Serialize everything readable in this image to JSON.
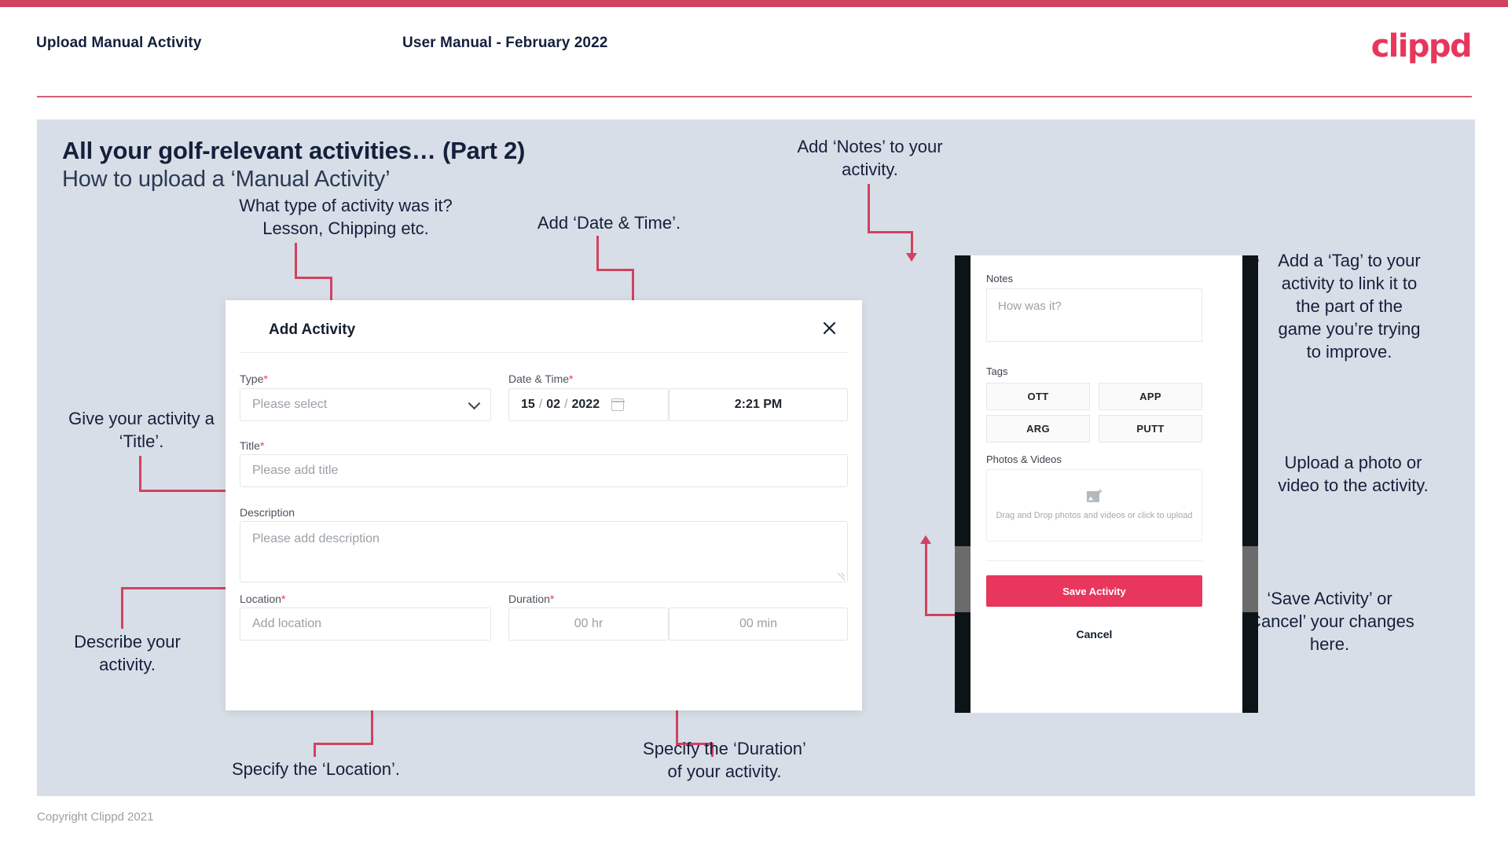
{
  "header": {
    "title": "Upload Manual Activity",
    "subtitle": "User Manual - February 2022",
    "logo": "clippd"
  },
  "slide": {
    "title": "All your golf-relevant activities… (Part 2)",
    "subtitle": "How to upload a ‘Manual Activity’"
  },
  "annotations": {
    "type": "What type of activity was it?\nLesson, Chipping etc.",
    "datetime": "Add ‘Date & Time’.",
    "title": "Give your activity a\n‘Title’.",
    "description": "Describe your\nactivity.",
    "location": "Specify the ‘Location’.",
    "duration": "Specify the ‘Duration’\nof your activity.",
    "notes": "Add ‘Notes’ to your\nactivity.",
    "tags": "Add a ‘Tag’ to your\nactivity to link it to\nthe part of the\ngame you’re trying\nto improve.",
    "photos": "Upload a photo or\nvideo to the activity.",
    "save": "‘Save Activity’ or\n‘Cancel’ your changes\nhere."
  },
  "dialog": {
    "title": "Add Activity",
    "close_icon": "close-icon",
    "fields": {
      "type_label": "Type",
      "type_placeholder": "Please select",
      "datetime_label": "Date & Time",
      "date_day": "15",
      "date_sep1": "/",
      "date_month": "02",
      "date_sep2": "/",
      "date_year": "2022",
      "time_value": "2:21 PM",
      "title_label": "Title",
      "title_placeholder": "Please add title",
      "description_label": "Description",
      "description_placeholder": "Please add description",
      "location_label": "Location",
      "location_placeholder": "Add location",
      "duration_label": "Duration",
      "duration_hr_placeholder": "00 hr",
      "duration_min_placeholder": "00 min"
    },
    "required_marker": "*"
  },
  "phone": {
    "notes_label": "Notes",
    "notes_placeholder": "How was it?",
    "tags_label": "Tags",
    "tags": [
      "OTT",
      "APP",
      "ARG",
      "PUTT"
    ],
    "photos_label": "Photos & Videos",
    "dropzone_text": "Drag and Drop photos and videos or\nclick to upload",
    "save_label": "Save Activity",
    "cancel_label": "Cancel"
  },
  "footer": {
    "copyright": "Copyright Clippd 2021"
  },
  "colors": {
    "accent": "#cf4360",
    "brand": "#e8365d",
    "slide_bg": "#d8dee7",
    "ink": "#14203c"
  }
}
